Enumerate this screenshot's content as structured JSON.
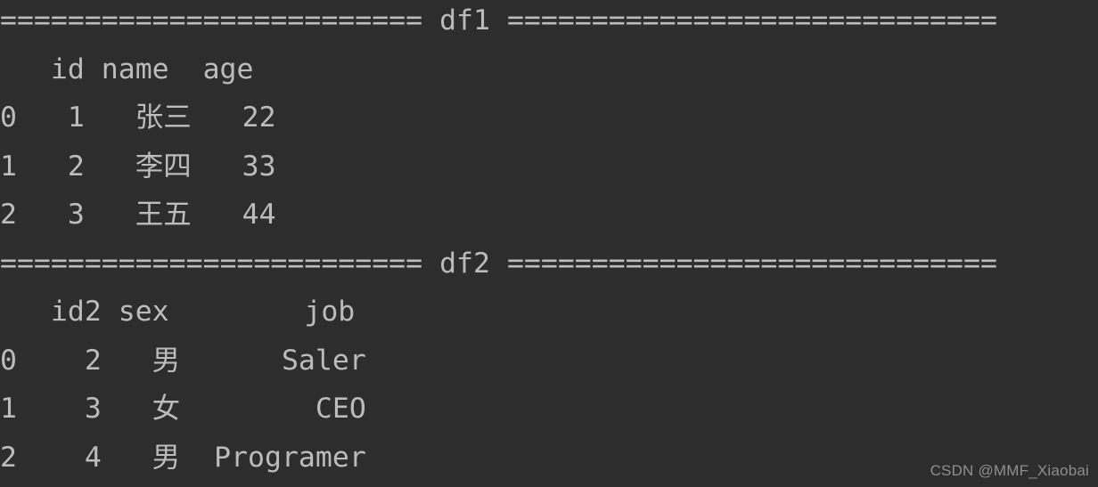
{
  "terminal": {
    "background_color": "#2d2d2d",
    "text_color": "#bcbcbc",
    "lines": [
      "========================= df1 =============================",
      "   id name  age",
      "0   1   张三   22",
      "1   2   李四   33",
      "2   3   王五   44",
      "========================= df2 =============================",
      "   id2 sex        job",
      "0    2   男      Saler",
      "1    3   女        CEO",
      "2    4   男  Programer"
    ],
    "dataframes": [
      {
        "name": "df1",
        "separator": "========================= df1 =============================",
        "index_name": "",
        "columns": [
          "id",
          "name",
          "age"
        ],
        "index": [
          "0",
          "1",
          "2"
        ],
        "rows": [
          [
            "1",
            "张三",
            "22"
          ],
          [
            "2",
            "李四",
            "33"
          ],
          [
            "3",
            "王五",
            "44"
          ]
        ]
      },
      {
        "name": "df2",
        "separator": "========================= df2 =============================",
        "index_name": "",
        "columns": [
          "id2",
          "sex",
          "job"
        ],
        "index": [
          "0",
          "1",
          "2"
        ],
        "rows": [
          [
            "2",
            "男",
            "Saler"
          ],
          [
            "3",
            "女",
            "CEO"
          ],
          [
            "4",
            "男",
            "Programer"
          ]
        ]
      }
    ]
  },
  "watermark": {
    "text": "CSDN @MMF_Xiaobai",
    "color": "#8e8e8e"
  }
}
